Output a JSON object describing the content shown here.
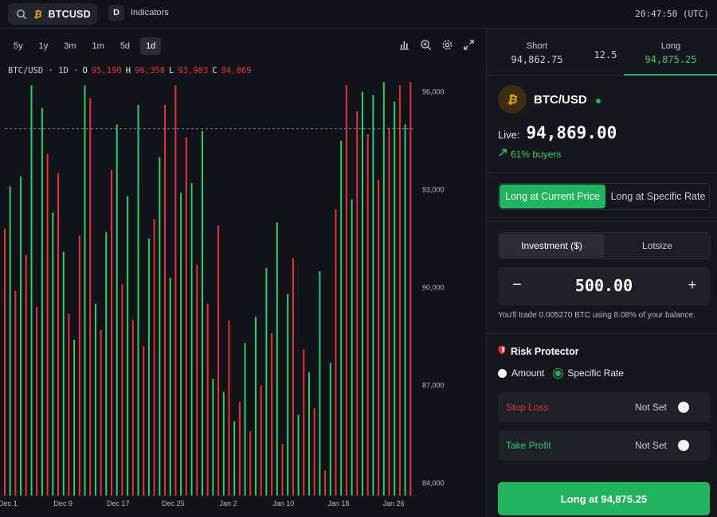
{
  "topbar": {
    "symbol": "BTCUSD",
    "symbol_icon": "bitcoin-icon",
    "interval_badge": "D",
    "indicators_label": "Indicators",
    "clock": "20:47:50 (UTC)"
  },
  "chart_panel": {
    "ranges": [
      "5y",
      "1y",
      "3m",
      "1m",
      "5d",
      "1d"
    ],
    "active_range": "1d",
    "tools": [
      "bar-chart-icon",
      "zoom-in-icon",
      "gear-icon",
      "expand-icon"
    ],
    "ohlc": {
      "pair": "BTC/USD · 1D ·",
      "o_label": "O",
      "o": "95,190",
      "h_label": "H",
      "h": "96,358",
      "l_label": "L",
      "l": "93,903",
      "c_label": "C",
      "c": "94,869"
    }
  },
  "chart_data": {
    "type": "bar",
    "x_tick_labels": [
      "Dec 1",
      "Dec 9",
      "Dec 17",
      "Dec 25",
      "Jan 2",
      "Jan 10",
      "Jan 18",
      "Jan 26"
    ],
    "y_tick_labels": [
      "96,000",
      "93,000",
      "90,000",
      "87,000",
      "84,000"
    ],
    "ylim": [
      83600,
      96400
    ],
    "reference_line": 94869,
    "up_color": "#2ecc71",
    "down_color": "#e2333b",
    "bars": [
      {
        "dir": "down",
        "low": 83600,
        "high": 91800
      },
      {
        "dir": "up",
        "low": 83600,
        "high": 93100
      },
      {
        "dir": "down",
        "low": 83600,
        "high": 89900
      },
      {
        "dir": "up",
        "low": 83600,
        "high": 93400
      },
      {
        "dir": "down",
        "low": 83600,
        "high": 91000
      },
      {
        "dir": "up",
        "low": 83600,
        "high": 96200
      },
      {
        "dir": "down",
        "low": 83600,
        "high": 89400
      },
      {
        "dir": "up",
        "low": 83600,
        "high": 95500
      },
      {
        "dir": "down",
        "low": 83600,
        "high": 94100
      },
      {
        "dir": "up",
        "low": 83600,
        "high": 92300
      },
      {
        "dir": "down",
        "low": 83600,
        "high": 93500
      },
      {
        "dir": "up",
        "low": 83600,
        "high": 91100
      },
      {
        "dir": "down",
        "low": 83600,
        "high": 89200
      },
      {
        "dir": "up",
        "low": 83600,
        "high": 88400
      },
      {
        "dir": "down",
        "low": 83600,
        "high": 91600
      },
      {
        "dir": "up",
        "low": 83600,
        "high": 96200
      },
      {
        "dir": "down",
        "low": 83600,
        "high": 95800
      },
      {
        "dir": "up",
        "low": 83600,
        "high": 89500
      },
      {
        "dir": "down",
        "low": 83600,
        "high": 88700
      },
      {
        "dir": "up",
        "low": 83600,
        "high": 91700
      },
      {
        "dir": "down",
        "low": 83600,
        "high": 93600
      },
      {
        "dir": "up",
        "low": 83600,
        "high": 95000
      },
      {
        "dir": "down",
        "low": 83600,
        "high": 90100
      },
      {
        "dir": "up",
        "low": 83600,
        "high": 92800
      },
      {
        "dir": "down",
        "low": 83600,
        "high": 89000
      },
      {
        "dir": "up",
        "low": 83600,
        "high": 95600
      },
      {
        "dir": "down",
        "low": 83600,
        "high": 88200
      },
      {
        "dir": "up",
        "low": 83600,
        "high": 91500
      },
      {
        "dir": "down",
        "low": 83600,
        "high": 92100
      },
      {
        "dir": "up",
        "low": 83600,
        "high": 94000
      },
      {
        "dir": "down",
        "low": 83600,
        "high": 95600
      },
      {
        "dir": "up",
        "low": 83600,
        "high": 90300
      },
      {
        "dir": "down",
        "low": 83600,
        "high": 96200
      },
      {
        "dir": "up",
        "low": 83600,
        "high": 92900
      },
      {
        "dir": "down",
        "low": 83600,
        "high": 94600
      },
      {
        "dir": "up",
        "low": 83600,
        "high": 93200
      },
      {
        "dir": "down",
        "low": 83600,
        "high": 90700
      },
      {
        "dir": "up",
        "low": 83600,
        "high": 94800
      },
      {
        "dir": "down",
        "low": 83600,
        "high": 89500
      },
      {
        "dir": "up",
        "low": 83600,
        "high": 87200
      },
      {
        "dir": "down",
        "low": 83600,
        "high": 91900
      },
      {
        "dir": "up",
        "low": 83600,
        "high": 86800
      },
      {
        "dir": "down",
        "low": 83600,
        "high": 89000
      },
      {
        "dir": "up",
        "low": 83600,
        "high": 85900
      },
      {
        "dir": "down",
        "low": 83600,
        "high": 86500
      },
      {
        "dir": "up",
        "low": 83600,
        "high": 88300
      },
      {
        "dir": "down",
        "low": 83600,
        "high": 85600
      },
      {
        "dir": "up",
        "low": 83600,
        "high": 89100
      },
      {
        "dir": "down",
        "low": 83600,
        "high": 87000
      },
      {
        "dir": "up",
        "low": 83600,
        "high": 90600
      },
      {
        "dir": "down",
        "low": 83600,
        "high": 88600
      },
      {
        "dir": "up",
        "low": 83600,
        "high": 92000
      },
      {
        "dir": "down",
        "low": 83600,
        "high": 85200
      },
      {
        "dir": "up",
        "low": 83600,
        "high": 89800
      },
      {
        "dir": "down",
        "low": 83600,
        "high": 90900
      },
      {
        "dir": "up",
        "low": 83600,
        "high": 86100
      },
      {
        "dir": "down",
        "low": 83600,
        "high": 88100
      },
      {
        "dir": "up",
        "low": 83600,
        "high": 87400
      },
      {
        "dir": "down",
        "low": 83600,
        "high": 86300
      },
      {
        "dir": "up",
        "low": 83600,
        "high": 90500
      },
      {
        "dir": "down",
        "low": 83600,
        "high": 84400
      },
      {
        "dir": "up",
        "low": 83600,
        "high": 87700
      },
      {
        "dir": "down",
        "low": 83600,
        "high": 92400
      },
      {
        "dir": "up",
        "low": 83600,
        "high": 94500
      },
      {
        "dir": "down",
        "low": 83600,
        "high": 96200
      },
      {
        "dir": "up",
        "low": 83600,
        "high": 92700
      },
      {
        "dir": "down",
        "low": 83600,
        "high": 95400
      },
      {
        "dir": "up",
        "low": 83600,
        "high": 96000
      },
      {
        "dir": "down",
        "low": 83600,
        "high": 94700
      },
      {
        "dir": "up",
        "low": 83600,
        "high": 95900
      },
      {
        "dir": "down",
        "low": 83600,
        "high": 93300
      },
      {
        "dir": "up",
        "low": 83600,
        "high": 96300
      },
      {
        "dir": "down",
        "low": 83600,
        "high": 94900
      },
      {
        "dir": "up",
        "low": 83600,
        "high": 95700
      },
      {
        "dir": "down",
        "low": 83600,
        "high": 96200
      },
      {
        "dir": "up",
        "low": 83600,
        "high": 95000
      },
      {
        "dir": "down",
        "low": 83600,
        "high": 96300
      }
    ]
  },
  "trade_panel": {
    "short_label": "Short",
    "short_price": "94,862.75",
    "spread": "12.5",
    "long_label": "Long",
    "long_price": "94,875.25",
    "asset_name": "BTC/USD",
    "live_label": "Live:",
    "live_price": "94,869.00",
    "buyers_text": "61% buyers",
    "mode_active": "Long at Current Price",
    "mode_inactive": "Long at Specific Rate",
    "invest_tab": "Investment ($)",
    "lot_tab": "Lotsize",
    "amount": "500.00",
    "minus": "−",
    "plus": "+",
    "trade_note": "You'll trade 0.005270 BTC using 8.08% of your balance.",
    "risk_title": "Risk Protector",
    "radio_amount": "Amount",
    "radio_rate": "Specific Rate",
    "stop_loss_label": "Stop Loss",
    "stop_loss_state": "Not Set",
    "take_profit_label": "Take Profit",
    "take_profit_state": "Not Set",
    "cta_label": "Long at 94,875.25",
    "colors": {
      "accent_green": "#22b35e",
      "sell_red": "#e2333b",
      "profit_green": "#2ecc71"
    }
  }
}
